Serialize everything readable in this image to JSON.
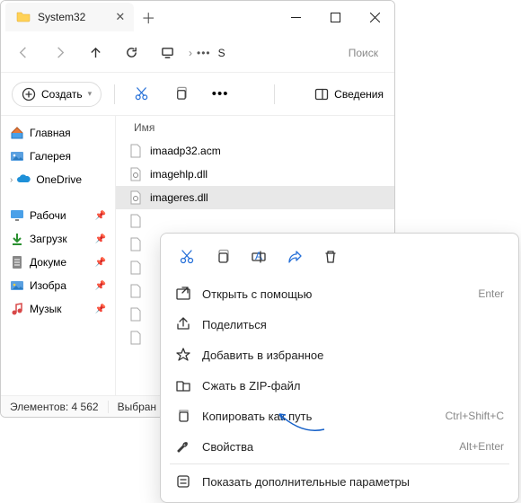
{
  "window": {
    "tab_title": "System32"
  },
  "navbar": {
    "breadcrumb": "S",
    "search_placeholder": "Поиск"
  },
  "toolbar": {
    "create_label": "Создать",
    "details_label": "Сведения"
  },
  "sidebar": {
    "home": "Главная",
    "gallery": "Галерея",
    "onedrive": "OneDrive",
    "desktop": "Рабочи",
    "downloads": "Загрузк",
    "documents": "Докуме",
    "pictures": "Изобра",
    "music": "Музык"
  },
  "main": {
    "column_name": "Имя",
    "files": [
      "imaadp32.acm",
      "imagehlp.dll",
      "imageres.dll"
    ]
  },
  "status": {
    "count_label": "Элементов: 4 562",
    "selection_label": "Выбран"
  },
  "context": {
    "open_with": "Открыть с помощью",
    "open_with_hint": "Enter",
    "share": "Поделиться",
    "favorite": "Добавить в избранное",
    "zip": "Сжать в ZIP-файл",
    "copy_path": "Копировать как путь",
    "copy_path_hint": "Ctrl+Shift+C",
    "properties": "Свойства",
    "properties_hint": "Alt+Enter",
    "more": "Показать дополнительные параметры"
  }
}
